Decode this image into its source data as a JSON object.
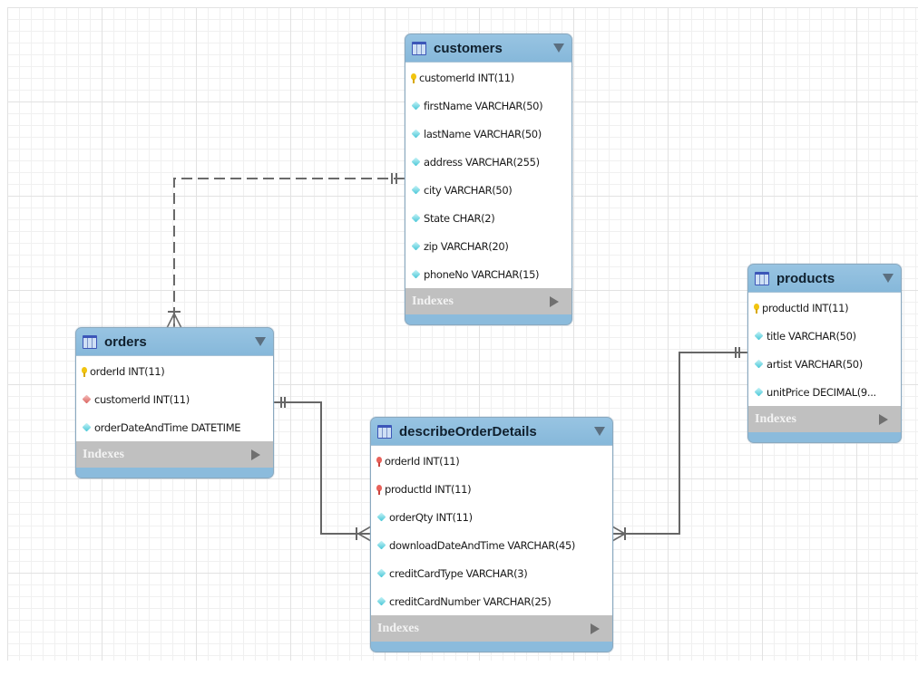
{
  "entities": {
    "customers": {
      "name": "customers",
      "indexes_label": "Indexes",
      "columns": [
        {
          "text": "customerId INT(11)",
          "key": "primary"
        },
        {
          "text": "firstName VARCHAR(50)",
          "key": "attribute"
        },
        {
          "text": "lastName VARCHAR(50)",
          "key": "attribute"
        },
        {
          "text": "address VARCHAR(255)",
          "key": "attribute"
        },
        {
          "text": "city VARCHAR(50)",
          "key": "attribute"
        },
        {
          "text": "State CHAR(2)",
          "key": "attribute"
        },
        {
          "text": "zip VARCHAR(20)",
          "key": "attribute"
        },
        {
          "text": "phoneNo VARCHAR(15)",
          "key": "attribute"
        }
      ]
    },
    "orders": {
      "name": "orders",
      "indexes_label": "Indexes",
      "columns": [
        {
          "text": "orderId INT(11)",
          "key": "primary"
        },
        {
          "text": "customerId INT(11)",
          "key": "foreign"
        },
        {
          "text": "orderDateAndTime DATETIME",
          "key": "attribute"
        }
      ]
    },
    "describeOrderDetails": {
      "name": "describeOrderDetails",
      "indexes_label": "Indexes",
      "columns": [
        {
          "text": "orderId INT(11)",
          "key": "primary-foreign"
        },
        {
          "text": "productId INT(11)",
          "key": "primary-foreign"
        },
        {
          "text": "orderQty INT(11)",
          "key": "attribute"
        },
        {
          "text": "downloadDateAndTime VARCHAR(45)",
          "key": "attribute"
        },
        {
          "text": "creditCardType VARCHAR(3)",
          "key": "attribute"
        },
        {
          "text": "creditCardNumber VARCHAR(25)",
          "key": "attribute"
        }
      ]
    },
    "products": {
      "name": "products",
      "indexes_label": "Indexes",
      "columns": [
        {
          "text": "productId INT(11)",
          "key": "primary"
        },
        {
          "text": "title VARCHAR(50)",
          "key": "attribute"
        },
        {
          "text": "artist VARCHAR(50)",
          "key": "attribute"
        },
        {
          "text": "unitPrice DECIMAL(9...",
          "key": "attribute"
        }
      ]
    }
  },
  "relationships": [
    {
      "from": "customers",
      "to": "orders",
      "from_cardinality": "one-and-only-one",
      "to_cardinality": "one-or-many",
      "identifying": false
    },
    {
      "from": "orders",
      "to": "describeOrderDetails",
      "from_cardinality": "one-and-only-one",
      "to_cardinality": "one-or-many",
      "identifying": true
    },
    {
      "from": "products",
      "to": "describeOrderDetails",
      "from_cardinality": "one-and-only-one",
      "to_cardinality": "one-or-many",
      "identifying": true
    }
  ],
  "colors": {
    "header": "#86b8da",
    "indexes_bar": "#c0c0c0",
    "primary_key": "#f1c40f",
    "foreign_key": "#d9605c",
    "attribute": "#46c6d6",
    "connector": "#666666"
  }
}
